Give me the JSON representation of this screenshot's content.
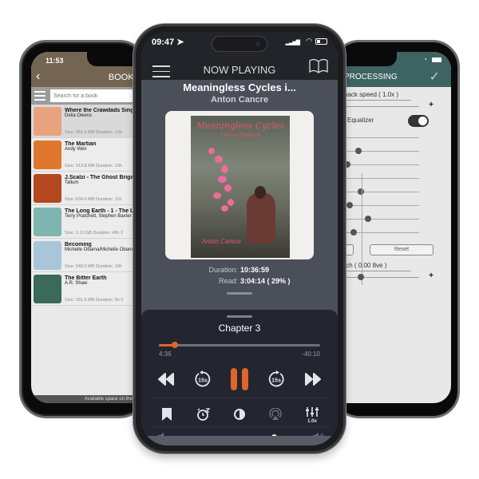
{
  "left_phone": {
    "status_time": "11:53",
    "header_title": "BOOKS",
    "search_placeholder": "Search for a book",
    "books": [
      {
        "title": "Where the Crawdads Sing",
        "author": "Delia Owens",
        "meta": "Size: 351.6 MB   Duration: 12h",
        "cover_color": "#e9a27d"
      },
      {
        "title": "The Martian",
        "author": "Andy Weir",
        "meta": "Size: 313.8 MB   Duration: 10h",
        "cover_color": "#e0772f"
      },
      {
        "title": "J.Scalzi - The Ghost Brigades",
        "author": "Tallum",
        "meta": "Size: 634.6 MB   Duration: 11h",
        "cover_color": "#b5471e"
      },
      {
        "title": "The Long Earth - 1 - The Long Earth",
        "author": "Terry Pratchett, Stephen Baxter",
        "meta": "Size: 1.13 GB   Duration: 49h 2",
        "cover_color": "#7fb5b0"
      },
      {
        "title": "Becoming",
        "author": "Michelle Obama/Michelle Obama",
        "meta": "Size: 548.9 MB   Duration: 19h",
        "cover_color": "#a8c6d8"
      },
      {
        "title": "The Bitter Earth",
        "author": "A.R. Shaw",
        "meta": "Size: 151.6 MB   Duration: 5h 0",
        "cover_color": "#3a6a5a"
      }
    ],
    "footer": "Available space on the device"
  },
  "right_phone": {
    "header_title": "PROCESSING",
    "playback_speed_label": "back speed ( 1.0x )",
    "equalizer_label": "Equalizer",
    "equalizer_enabled": true,
    "eq_band_levels": [
      0.03,
      0.26,
      0.13,
      0.06,
      0.29,
      0.16,
      0.37,
      0.2
    ],
    "speed_level": 0.0,
    "reset_label": "Reset",
    "pitch_label": "tch ( 0.00 8ve )",
    "pitch_level": 0.29,
    "plus_label": "+"
  },
  "center_phone": {
    "status_time": "09:47",
    "nav_title": "NOW PLAYING",
    "book_title": "Meaningless Cycles i...",
    "author": "Anton Cancre",
    "cover": {
      "title": "Meaningless Cycles",
      "subtitle": "A Horror Chapbook",
      "author": "Anton Cancre"
    },
    "duration_label": "Duration:",
    "duration_value": "10:36:59",
    "read_label": "Read:",
    "read_value": "3:04:14 ( 29% )",
    "chapter": "Chapter 3",
    "elapsed": "4:36",
    "remaining": "-40:10",
    "chapter_progress": 0.1,
    "skip_back_label": "15s",
    "skip_forward_label": "15s",
    "speed_badge": "1.0x",
    "volume_level": 0.76,
    "accent_color": "#e0642b"
  }
}
